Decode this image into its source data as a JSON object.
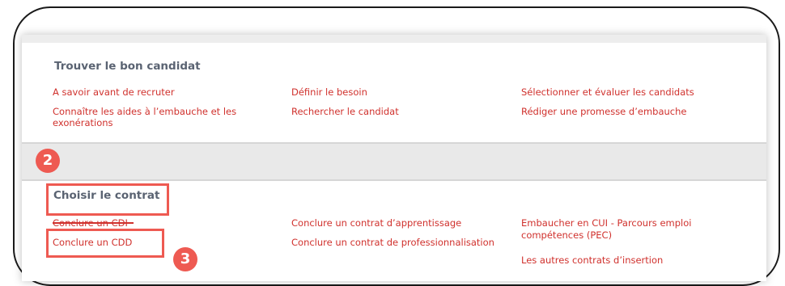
{
  "section1": {
    "title": "Trouver le bon candidat",
    "links": [
      "A savoir avant de recruter",
      "Définir le besoin",
      "Sélectionner et évaluer les candidats",
      "Connaître les aides à l’embauche et les",
      "exonérations",
      "Rechercher le candidat",
      "Rédiger une promesse d’embauche"
    ]
  },
  "section2": {
    "title": "Choisir le contrat",
    "links": [
      "Conclure un CDI",
      "Conclure un contrat d’apprentissage",
      "Embaucher en CUI - Parcours emploi",
      "compétences (PEC)",
      "Conclure un CDD",
      "Conclure un contrat de professionnalisation",
      "Les autres contrats d’insertion"
    ]
  },
  "badges": [
    "2",
    "3"
  ],
  "colors": {
    "link": "#d0312d",
    "highlight": "#ee5a52",
    "title": "#5a6372",
    "band": "#e9e9e9"
  }
}
